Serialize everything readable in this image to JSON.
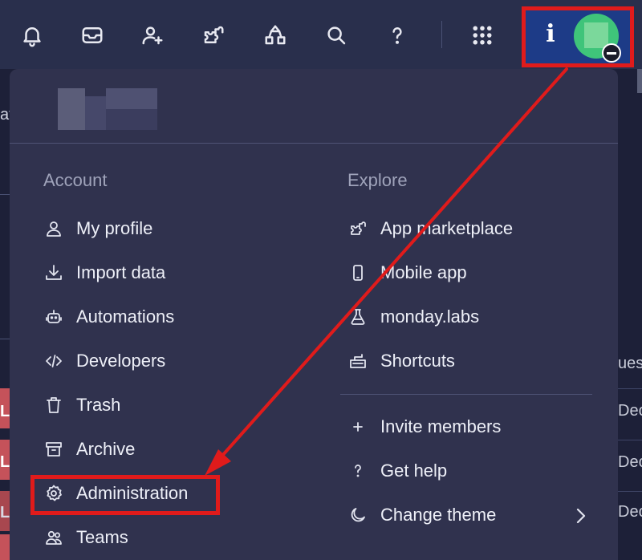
{
  "topbar": {
    "icons": [
      {
        "name": "bell-icon"
      },
      {
        "name": "inbox-icon"
      },
      {
        "name": "invite-user-icon"
      },
      {
        "name": "apps-puzzle-icon"
      },
      {
        "name": "workflow-icon"
      },
      {
        "name": "search-icon"
      },
      {
        "name": "help-icon"
      },
      {
        "name": "app-grid-icon"
      }
    ],
    "info_glyph": "i",
    "highlight_color": "#e01b1b"
  },
  "background": {
    "edge_text": "at",
    "row_letter": "L",
    "right_cells": [
      "ues",
      "Dec",
      "Dec",
      "Dec"
    ]
  },
  "menu": {
    "account": {
      "title": "Account",
      "items": [
        {
          "label": "My profile",
          "icon": "person-icon"
        },
        {
          "label": "Import data",
          "icon": "download-icon"
        },
        {
          "label": "Automations",
          "icon": "robot-icon"
        },
        {
          "label": "Developers",
          "icon": "code-icon"
        },
        {
          "label": "Trash",
          "icon": "trash-icon"
        },
        {
          "label": "Archive",
          "icon": "archive-icon"
        },
        {
          "label": "Administration",
          "icon": "gear-icon"
        },
        {
          "label": "Teams",
          "icon": "team-icon"
        }
      ]
    },
    "explore": {
      "title": "Explore",
      "items": [
        {
          "label": "App marketplace",
          "icon": "puzzle-icon"
        },
        {
          "label": "Mobile app",
          "icon": "mobile-icon"
        },
        {
          "label": "monday.labs",
          "icon": "flask-icon"
        },
        {
          "label": "Shortcuts",
          "icon": "keyboard-icon"
        }
      ]
    },
    "extras": {
      "items": [
        {
          "label": "Invite members",
          "icon": "plus-icon"
        },
        {
          "label": "Get help",
          "icon": "question-icon"
        },
        {
          "label": "Change theme",
          "icon": "moon-icon"
        }
      ]
    }
  }
}
